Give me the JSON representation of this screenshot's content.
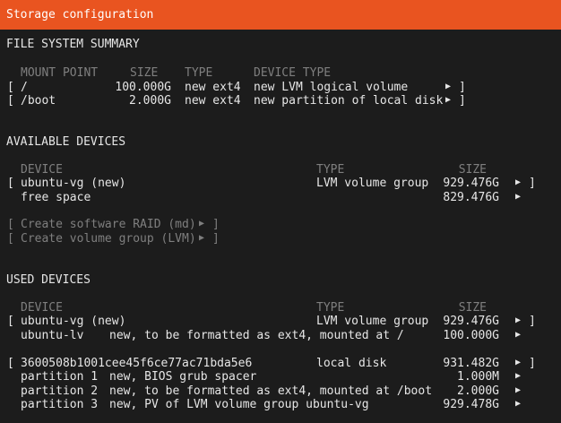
{
  "title": "Storage configuration",
  "fs_summary": {
    "heading": "FILE SYSTEM SUMMARY",
    "headers": {
      "mount": "MOUNT POINT",
      "size": "SIZE",
      "type": "TYPE",
      "device_type": "DEVICE TYPE"
    },
    "rows": [
      {
        "mount": "/",
        "size": "100.000G",
        "type": "new ext4",
        "device_type": "new LVM logical volume"
      },
      {
        "mount": "/boot",
        "size": "2.000G",
        "type": "new ext4",
        "device_type": "new partition of local disk"
      }
    ]
  },
  "available": {
    "heading": "AVAILABLE DEVICES",
    "headers": {
      "device": "DEVICE",
      "type": "TYPE",
      "size": "SIZE"
    },
    "vg": {
      "device": "ubuntu-vg (new)",
      "type": "LVM volume group",
      "size": "929.476G"
    },
    "free": {
      "label": "free space",
      "size": "829.476G"
    },
    "raid_label": "Create software RAID (md)",
    "lvm_label": "Create volume group (LVM)"
  },
  "used": {
    "heading": "USED DEVICES",
    "headers": {
      "device": "DEVICE",
      "type": "TYPE",
      "size": "SIZE"
    },
    "vg": {
      "device": "ubuntu-vg (new)",
      "type": "LVM volume group",
      "size": "929.476G"
    },
    "lv": {
      "name": "ubuntu-lv",
      "desc": "new, to be formatted as ext4, mounted at /",
      "size": "100.000G"
    },
    "disk": {
      "device": "3600508b1001cee45f6ce77ac71bda5e6",
      "type": "local disk",
      "size": "931.482G"
    },
    "partitions": [
      {
        "name": "partition 1",
        "desc": "new, BIOS grub spacer",
        "size": "1.000M"
      },
      {
        "name": "partition 2",
        "desc": "new, to be formatted as ext4, mounted at /boot",
        "size": "2.000G"
      },
      {
        "name": "partition 3",
        "desc": "new, PV of LVM volume group ubuntu-vg",
        "size": "929.478G"
      }
    ]
  },
  "glyphs": {
    "open": "[",
    "close": "]",
    "arrow": "▶"
  }
}
